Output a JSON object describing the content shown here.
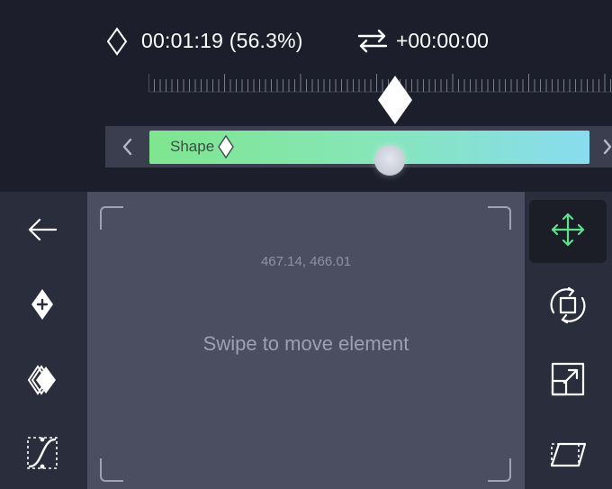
{
  "header": {
    "current_time": "00:01:19 (56.3%)",
    "offset": "+00:00:00"
  },
  "timeline": {
    "clip_label": "Shape"
  },
  "canvas": {
    "coordinates": "467.14, 466.01",
    "hint": "Swipe to move element"
  },
  "left_tools": [
    "back-arrow-icon",
    "add-keyframe-icon",
    "layers-keyframe-icon",
    "easing-curve-icon"
  ],
  "right_tools": [
    "move-icon",
    "rotate-icon",
    "scale-icon",
    "skew-icon"
  ],
  "colors": {
    "background": "#1c1f2b",
    "rail": "#2a2d3b",
    "canvas": "#4a4e60",
    "accent": "#5fe08a",
    "clip_start": "#7fe58e",
    "clip_end": "#88dcef"
  }
}
